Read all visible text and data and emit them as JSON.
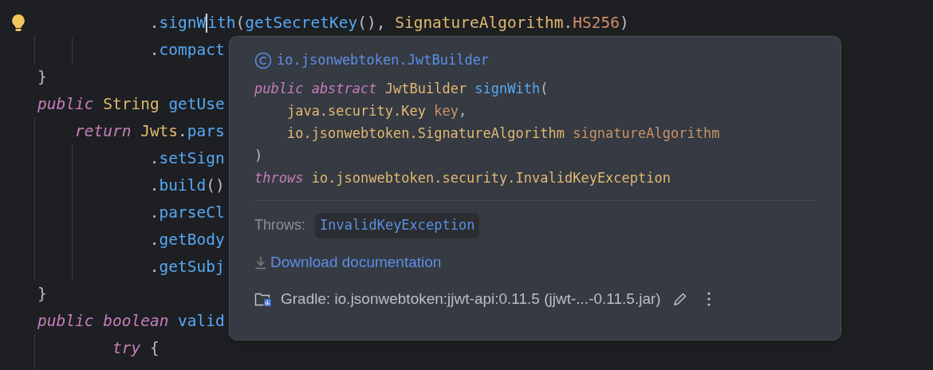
{
  "editor": {
    "lines": [
      {
        "kind": "statement",
        "children": [
          {
            "kind": "chain",
            "tokens": [
              {
                "kind": "punct",
                "text": "."
              },
              {
                "kind": "method",
                "text": "signW"
              },
              {
                "kind": "caret"
              },
              {
                "kind": "method",
                "text": "ith"
              },
              {
                "kind": "punct",
                "text": "("
              },
              {
                "kind": "method",
                "text": "getSecretKey"
              },
              {
                "kind": "punct",
                "text": "(), "
              },
              {
                "kind": "type",
                "text": "SignatureAlgorithm"
              },
              {
                "kind": "punct",
                "text": "."
              },
              {
                "kind": "constant",
                "text": "HS256"
              },
              {
                "kind": "punct",
                "text": ")"
              }
            ]
          },
          {
            "kind": "chain",
            "tokens": [
              {
                "kind": "punct",
                "text": "."
              },
              {
                "kind": "method",
                "text": "compact"
              }
            ]
          }
        ]
      },
      {
        "kind": "top",
        "tokens": [
          {
            "kind": "punct",
            "text": "}"
          }
        ]
      },
      {
        "kind": "top",
        "tokens": [
          {
            "kind": "keyword",
            "text": "public "
          },
          {
            "kind": "type",
            "text": "String "
          },
          {
            "kind": "method",
            "text": "getUse"
          }
        ],
        "children": [
          {
            "kind": "statement",
            "tokens": [
              {
                "kind": "keyword",
                "text": "return "
              },
              {
                "kind": "type",
                "text": "Jwts"
              },
              {
                "kind": "punct",
                "text": "."
              },
              {
                "kind": "method",
                "text": "pars"
              }
            ],
            "children": [
              {
                "kind": "chain",
                "tokens": [
                  {
                    "kind": "punct",
                    "text": "."
                  },
                  {
                    "kind": "method",
                    "text": "setSign"
                  }
                ]
              },
              {
                "kind": "chain",
                "tokens": [
                  {
                    "kind": "punct",
                    "text": "."
                  },
                  {
                    "kind": "method",
                    "text": "build"
                  },
                  {
                    "kind": "punct",
                    "text": "()"
                  }
                ]
              },
              {
                "kind": "chain",
                "tokens": [
                  {
                    "kind": "punct",
                    "text": "."
                  },
                  {
                    "kind": "method",
                    "text": "parseCl"
                  }
                ]
              },
              {
                "kind": "chain",
                "tokens": [
                  {
                    "kind": "punct",
                    "text": "."
                  },
                  {
                    "kind": "method",
                    "text": "getBody"
                  }
                ]
              },
              {
                "kind": "chain",
                "tokens": [
                  {
                    "kind": "punct",
                    "text": "."
                  },
                  {
                    "kind": "method",
                    "text": "getSubj"
                  }
                ]
              }
            ]
          }
        ]
      },
      {
        "kind": "top",
        "tokens": [
          {
            "kind": "punct",
            "text": "}"
          }
        ]
      },
      {
        "kind": "top",
        "tokens": [
          {
            "kind": "keyword",
            "text": "public "
          },
          {
            "kind": "keyword",
            "text": "boolean "
          },
          {
            "kind": "method",
            "text": "valid"
          }
        ],
        "children": [
          {
            "kind": "chain",
            "tokens": [
              {
                "kind": "keyword",
                "text": "try "
              },
              {
                "kind": "punct",
                "text": "{"
              }
            ]
          }
        ]
      }
    ]
  },
  "popup": {
    "class_name": "io.jsonwebtoken.JwtBuilder",
    "signature": [
      {
        "tokens": [
          {
            "kind": "keyword",
            "text": "public abstract "
          },
          {
            "kind": "type",
            "text": "JwtBuilder "
          },
          {
            "kind": "method",
            "text": "signWith"
          },
          {
            "kind": "punct",
            "text": "("
          }
        ],
        "children": [
          {
            "tokens": [
              {
                "kind": "type",
                "text": "java.security.Key "
              },
              {
                "kind": "param",
                "text": "key"
              },
              {
                "kind": "punct",
                "text": ","
              }
            ]
          },
          {
            "tokens": [
              {
                "kind": "type",
                "text": "io.jsonwebtoken.SignatureAlgorithm "
              },
              {
                "kind": "param",
                "text": "signatureAlgorithm"
              }
            ]
          }
        ]
      },
      {
        "tokens": [
          {
            "kind": "punct",
            "text": ")"
          }
        ]
      },
      {
        "tokens": [
          {
            "kind": "keyword",
            "text": "throws "
          },
          {
            "kind": "type",
            "text": "io.jsonwebtoken.security.InvalidKeyException"
          }
        ]
      }
    ],
    "throws_label": "Throws:",
    "throws_value": "InvalidKeyException",
    "download_link": "Download documentation",
    "library": "Gradle: io.jsonwebtoken:jjwt-api:0.11.5 (jjwt-...-0.11.5.jar)"
  }
}
